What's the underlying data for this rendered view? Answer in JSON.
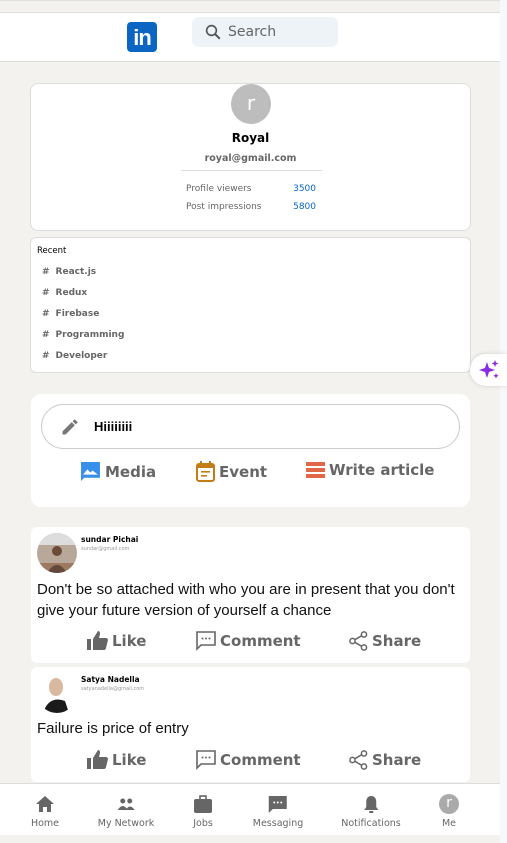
{
  "header": {
    "logo": "in",
    "search_placeholder": "Search"
  },
  "profile": {
    "avatar_letter": "r",
    "name": "Royal",
    "email": "royal@gmail.com",
    "stats": [
      {
        "label": "Profile viewers",
        "value": "3500"
      },
      {
        "label": "Post impressions",
        "value": "5800"
      }
    ]
  },
  "recent": {
    "title": "Recent",
    "tags": [
      "React.js",
      "Redux",
      "Firebase",
      "Programming",
      "Developer"
    ]
  },
  "composer": {
    "input_value": "Hiiiiiiii",
    "actions": [
      {
        "label": "Media",
        "icon": "image-icon",
        "color": "#378fe9"
      },
      {
        "label": "Event",
        "icon": "calendar-icon",
        "color": "#c37d16"
      },
      {
        "label": "Write article",
        "icon": "article-icon",
        "color": "#e06847"
      }
    ]
  },
  "posts": [
    {
      "author": "sundar Pichai",
      "email": "sundar@gmail.com",
      "text": "Don't be so attached with who you are in present that you don't give your future version of yourself a chance",
      "actions": [
        "Like",
        "Comment",
        "Share"
      ]
    },
    {
      "author": "Satya Nadella",
      "email": "satyanadella@gmail.com",
      "text": "Failure is price of entry",
      "actions": [
        "Like",
        "Comment",
        "Share"
      ]
    }
  ],
  "nav": {
    "items": [
      {
        "label": "Home",
        "icon": "home-icon"
      },
      {
        "label": "My Network",
        "icon": "network-icon"
      },
      {
        "label": "Jobs",
        "icon": "briefcase-icon"
      },
      {
        "label": "Messaging",
        "icon": "message-icon"
      },
      {
        "label": "Notifications",
        "icon": "bell-icon"
      },
      {
        "label": "Me",
        "icon": "avatar",
        "letter": "r"
      }
    ]
  },
  "colors": {
    "brand": "#0a66c2",
    "background": "#f3f2ef",
    "sparkle": "#8a2be2"
  }
}
